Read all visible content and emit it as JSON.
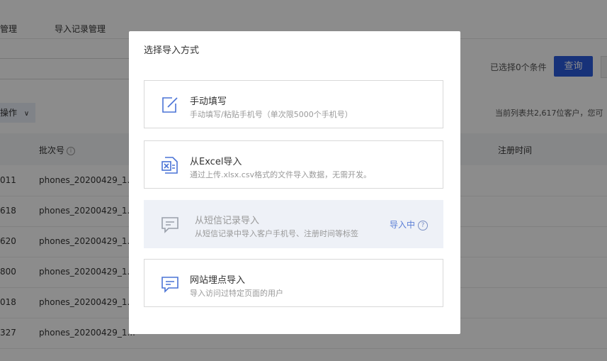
{
  "tabs": [
    {
      "label": "管理"
    },
    {
      "label": "导入记录管理"
    }
  ],
  "toolbar": {
    "selected_conditions": "已选择0个条件",
    "query_label": "查询",
    "operations_label": "操作",
    "total_text": "当前列表共2,617位客户，您可"
  },
  "table": {
    "headers": {
      "batch": "批次号",
      "register_time": "注册时间"
    },
    "rows": [
      {
        "id": "011",
        "batch": "phones_20200429_1..."
      },
      {
        "id": "618",
        "batch": "phones_20200429_1..."
      },
      {
        "id": "620",
        "batch": "phones_20200429_1..."
      },
      {
        "id": "800",
        "batch": "phones_20200429_1..."
      },
      {
        "id": "018",
        "batch": "phones_20200429_1..."
      },
      {
        "id": "327",
        "batch": "phones_20200429_1..."
      }
    ]
  },
  "modal": {
    "title": "选择导入方式",
    "options": [
      {
        "title": "手动填写",
        "desc": "手动填写/粘贴手机号（单次限5000个手机号）",
        "icon": "edit-icon"
      },
      {
        "title": "从Excel导入",
        "desc": "通过上传.xlsx.csv格式的文件导入数据，无需开发。",
        "icon": "excel-icon"
      },
      {
        "title": "从短信记录导入",
        "desc": "从短信记录中导入客户手机号、注册时间等标签",
        "icon": "message-icon",
        "status": "导入中",
        "disabled": true
      },
      {
        "title": "网站埋点导入",
        "desc": "导入访问过特定页面的用户",
        "icon": "message-icon"
      }
    ]
  },
  "colors": {
    "accent": "#2a5cdc",
    "icon_blue": "#4a73d6",
    "icon_gray": "#9aa0aa"
  }
}
